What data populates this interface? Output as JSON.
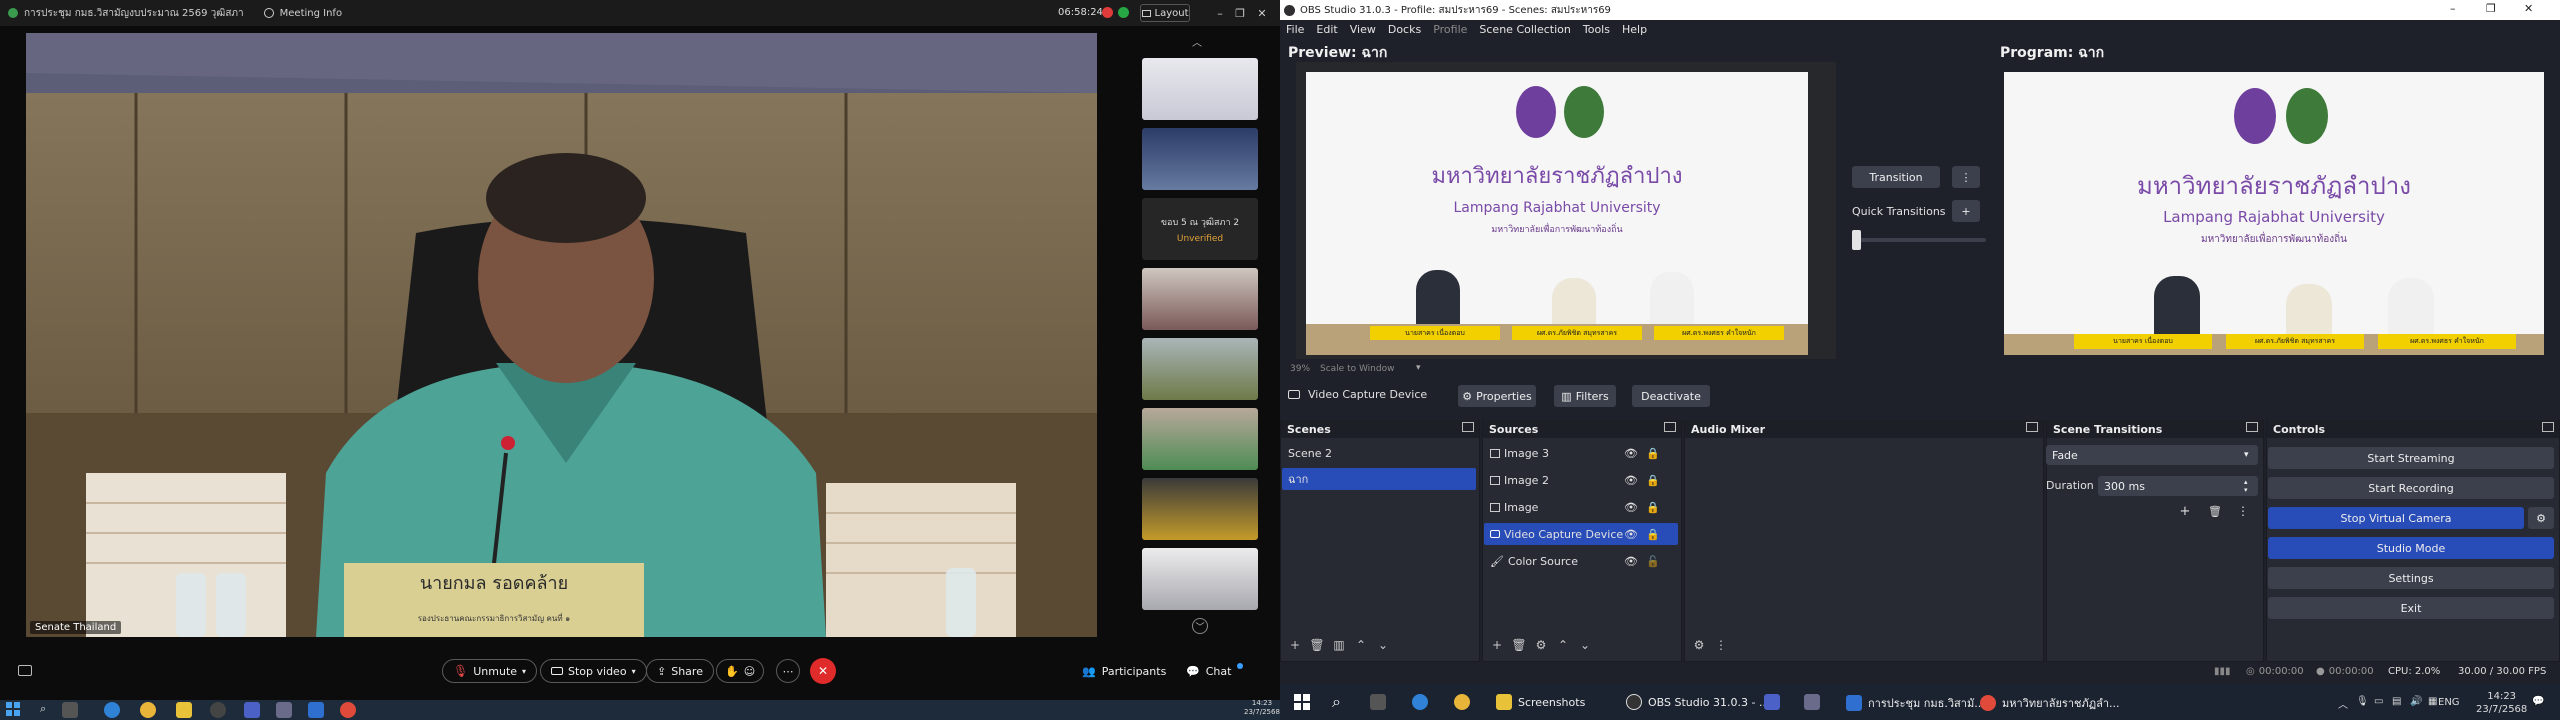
{
  "meeting": {
    "title": "การประชุม กมธ.วิสามัญงบประมาณ 2569 วุฒิสภา",
    "meeting_info": "Meeting Info",
    "elapsed": "06:58:24",
    "layout_label": "Layout",
    "speaker_label": "Senate Thailand",
    "nameplate_line1": "นายกมล รอดคล้าย",
    "nameplate_line2": "รองประธานคณะกรรมาธิการวิสามัญ คนที่ ๑",
    "participant_name": "ขอบ 5 ณ วุฒิสภา 2",
    "participant_status": "Unverified",
    "toolbar": {
      "unmute": "Unmute",
      "stop_video": "Stop video",
      "share": "Share",
      "participants": "Participants",
      "chat": "Chat"
    }
  },
  "obs": {
    "title": "OBS Studio 31.0.3 - Profile: สมประหาร69 - Scenes: สมประหาร69",
    "menu": [
      "File",
      "Edit",
      "View",
      "Docks",
      "Profile",
      "Scene Collection",
      "Tools",
      "Help"
    ],
    "preview_label": "Preview: ฉาก",
    "program_label": "Program: ฉาก",
    "zoom": "39%",
    "scale_mode": "Scale to Window",
    "transition_btn": "Transition",
    "quick_transitions": "Quick Transitions",
    "university_th": "มหาวิทยาลัยราชภัฏลำปาง",
    "university_en": "Lampang Rajabhat University",
    "university_motto": "มหาวิทยาลัยเพื่อการพัฒนาท้องถิ่น",
    "panelists": [
      "นายสาคร เนื่องตอบ",
      "ผศ.ดร.ภัยพิชิต สมุทรสาคร",
      "ผศ.ดร.พงศธร คำใจหนัก"
    ],
    "source_toolbar": {
      "source_name": "Video Capture Device",
      "properties": "Properties",
      "filters": "Filters",
      "deactivate": "Deactivate"
    },
    "docks": {
      "scenes": "Scenes",
      "sources": "Sources",
      "audio_mixer": "Audio Mixer",
      "scene_transitions": "Scene Transitions",
      "controls": "Controls"
    },
    "scenes": [
      "Scene 2",
      "ฉาก"
    ],
    "sources": [
      "Image 3",
      "Image 2",
      "Image",
      "Video Capture Device",
      "Color Source"
    ],
    "transition_type": "Fade",
    "duration_label": "Duration",
    "duration_value": "300 ms",
    "controls": [
      "Start Streaming",
      "Start Recording",
      "Stop Virtual Camera",
      "Studio Mode",
      "Settings",
      "Exit"
    ],
    "status": {
      "stream_time": "00:00:00",
      "rec_time": "00:00:00",
      "cpu": "CPU: 2.0%",
      "fps": "30.00 / 30.00 FPS"
    }
  },
  "taskbar": {
    "left_time": "14:23",
    "left_date": "23/7/2568",
    "right_apps": [
      "Screenshots",
      "OBS Studio 31.0.3 - ...",
      "การประชุม กมธ.วิสามั...",
      "มหาวิทยาลัยราชภัฏลำ..."
    ],
    "lang": "ENG",
    "right_time": "14:23",
    "right_date": "23/7/2568"
  }
}
